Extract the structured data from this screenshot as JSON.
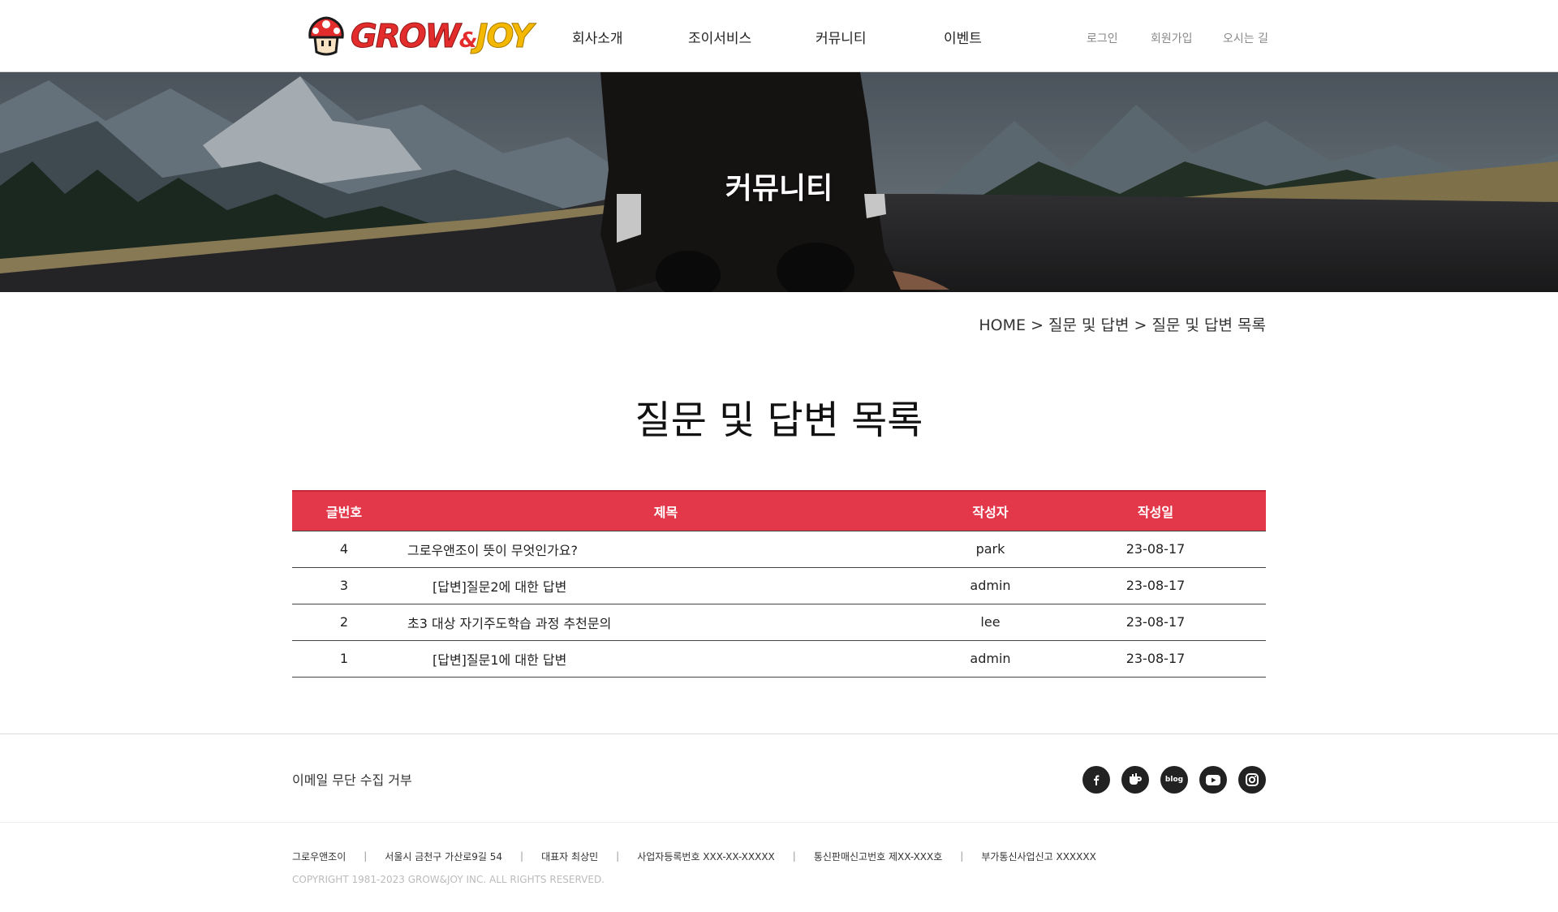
{
  "header": {
    "logo": {
      "text_grow": "GROW",
      "text_amp": "&",
      "text_joy": "JOY"
    },
    "nav": [
      "회사소개",
      "조이서비스",
      "커뮤니티",
      "이벤트"
    ],
    "util": [
      "로그인",
      "회원가입",
      "오시는 길"
    ]
  },
  "hero": {
    "title": "커뮤니티"
  },
  "breadcrumb": "HOME > 질문 및 답변 > 질문 및 답변 목록",
  "page": {
    "title": "질문 및 답변 목록"
  },
  "board": {
    "columns": [
      "글번호",
      "제목",
      "작성자",
      "작성일"
    ],
    "rows": [
      {
        "no": "4",
        "subject": "그로우앤조이 뜻이 무엇인가요?",
        "author": "park",
        "date": "23-08-17",
        "reply": false
      },
      {
        "no": "3",
        "subject": "[답변]질문2에 대한 답변",
        "author": "admin",
        "date": "23-08-17",
        "reply": true
      },
      {
        "no": "2",
        "subject": "초3 대상 자기주도학습 과정 추천문의",
        "author": "lee",
        "date": "23-08-17",
        "reply": false
      },
      {
        "no": "1",
        "subject": "[답변]질문1에 대한 답변",
        "author": "admin",
        "date": "23-08-17",
        "reply": true
      }
    ],
    "header_color": "#e3374a"
  },
  "footer": {
    "email_policy": "이메일 무단 수집 거부",
    "sns": [
      {
        "icon": "facebook-icon",
        "label": "f"
      },
      {
        "icon": "kakao-story-icon",
        "label": ""
      },
      {
        "icon": "blog-icon",
        "label": "blog"
      },
      {
        "icon": "youtube-icon",
        "label": ""
      },
      {
        "icon": "instagram-icon",
        "label": ""
      }
    ],
    "info": [
      "그로우앤조이",
      "서울시 금천구 가산로9길 54",
      "대표자 최상민",
      "사업자등록번호 XXX-XX-XXXXX",
      "통신판매신고번호 제XX-XXX호",
      "부가통신사업신고 XXXXXX"
    ],
    "copyright": "COPYRIGHT 1981-2023 GROW&JOY INC. ALL RIGHTS RESERVED."
  }
}
